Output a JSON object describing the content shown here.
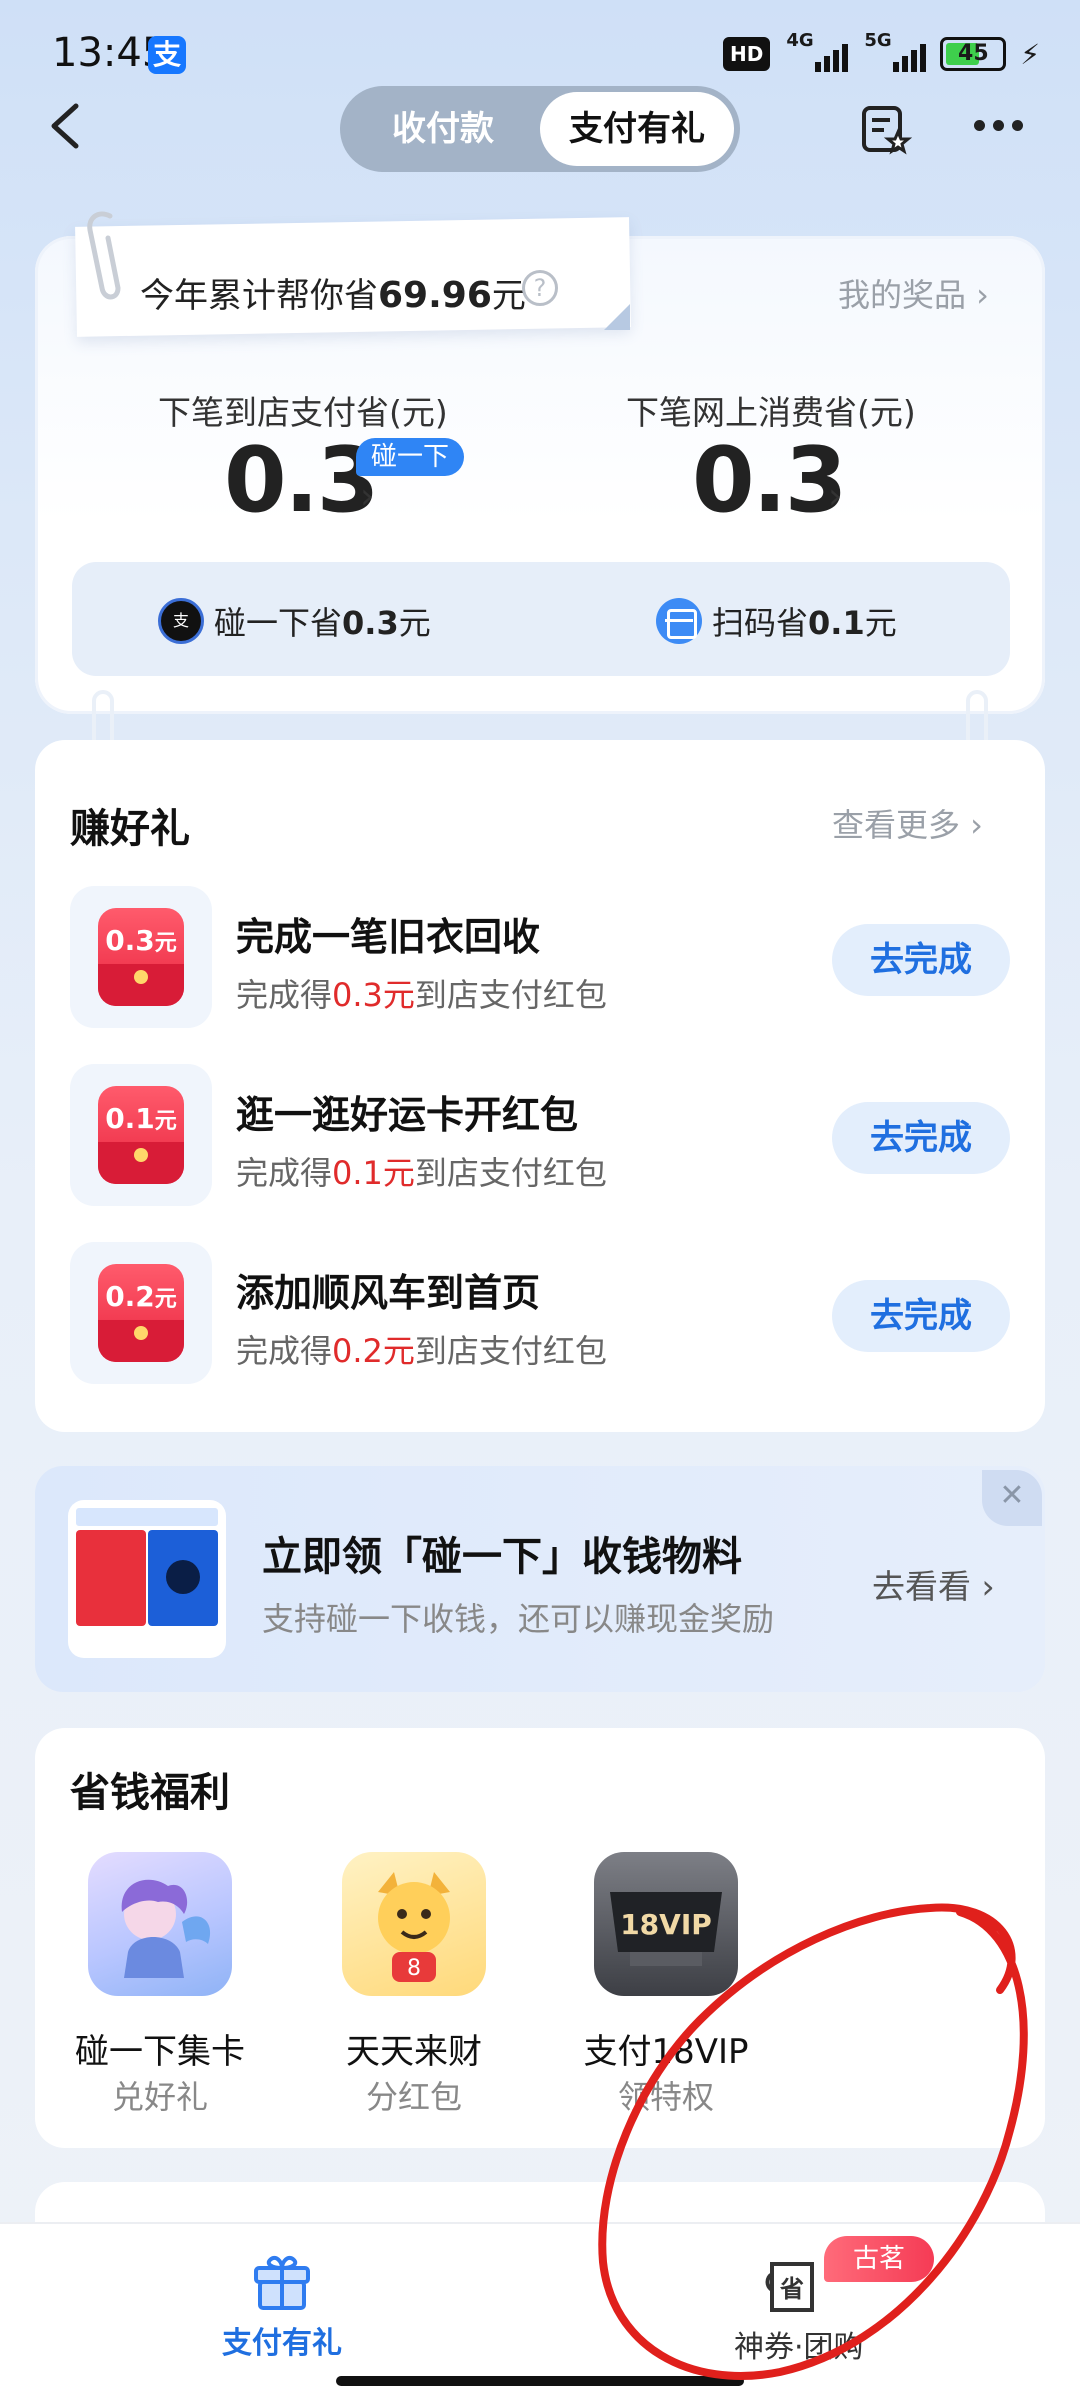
{
  "status_bar": {
    "time": "13:45",
    "app_badge": "支",
    "hd": "HD",
    "net1": "4G",
    "net2": "5G",
    "battery": "45",
    "bolt": "⚡"
  },
  "nav": {
    "tabs": [
      "收付款",
      "支付有礼"
    ],
    "active_tab": 1
  },
  "savings": {
    "summary_prefix": "今年累计帮你省",
    "summary_amount": "69.96",
    "summary_suffix": "元",
    "help_icon": "?",
    "my_prizes": "我的奖品 ›",
    "store_label": "下笔到店支付省(元)",
    "store_value": "0.3",
    "store_badge": "碰一下",
    "online_label": "下笔网上消费省(元)",
    "online_value": "0.3",
    "chevron": "›",
    "bump_prefix": "碰一下省",
    "bump_amount": "0.3",
    "bump_suffix": "元",
    "scan_prefix": "扫码省",
    "scan_amount": "0.1",
    "scan_suffix": "元"
  },
  "earn": {
    "title": "赚好礼",
    "see_more": "查看更多 ›",
    "tasks": [
      {
        "icon_value": "0.3",
        "icon_unit": "元",
        "title": "完成一笔旧衣回收",
        "sub_prefix": "完成得",
        "sub_amount": "0.3元",
        "sub_suffix": "到店支付红包",
        "button": "去完成"
      },
      {
        "icon_value": "0.1",
        "icon_unit": "元",
        "title": "逛一逛好运卡开红包",
        "sub_prefix": "完成得",
        "sub_amount": "0.1元",
        "sub_suffix": "到店支付红包",
        "button": "去完成"
      },
      {
        "icon_value": "0.2",
        "icon_unit": "元",
        "title": "添加顺风车到首页",
        "sub_prefix": "完成得",
        "sub_amount": "0.2元",
        "sub_suffix": "到店支付红包",
        "button": "去完成"
      }
    ]
  },
  "promo": {
    "title": "立即领「碰一下」收钱物料",
    "subtitle": "支持碰一下收钱，还可以赚现金奖励",
    "action": "去看看 ›",
    "close": "✕"
  },
  "welfare": {
    "title": "省钱福利",
    "items": [
      {
        "name": "碰一下集卡",
        "sub": "兑好礼"
      },
      {
        "name": "天天来财",
        "sub": "分红包"
      },
      {
        "name": "支付18VIP",
        "sub": "领特权",
        "icon_text": "18VIP"
      }
    ]
  },
  "tabbar": {
    "tab1": "支付有礼",
    "tab2": "神券·团购",
    "tab2_icon_text": "省",
    "tab2_badge": "古茗"
  },
  "colors": {
    "accent_blue": "#1f6fe0",
    "red": "#e02b2b",
    "annotation": "#e0201c"
  }
}
